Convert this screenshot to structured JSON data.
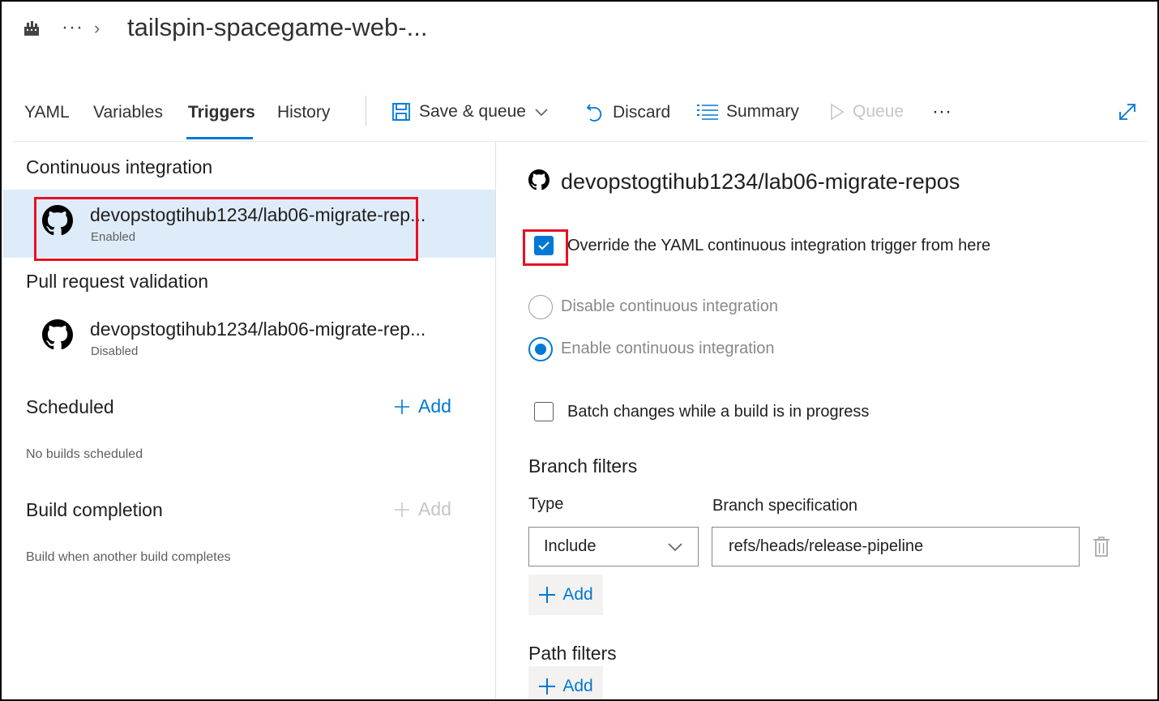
{
  "header": {
    "breadcrumb_more": "···",
    "breadcrumb_separator": "›",
    "title": "tailspin-spacegame-web-..."
  },
  "tabs": [
    {
      "label": "YAML"
    },
    {
      "label": "Variables"
    },
    {
      "label": "Triggers",
      "active": true
    },
    {
      "label": "History"
    }
  ],
  "toolbar": {
    "save_queue": "Save & queue",
    "discard": "Discard",
    "summary": "Summary",
    "queue": "Queue",
    "more": "···"
  },
  "left_panel": {
    "ci": {
      "title": "Continuous integration",
      "repo": "devopstogtihub1234/lab06-migrate-rep...",
      "status": "Enabled"
    },
    "pr": {
      "title": "Pull request validation",
      "repo": "devopstogtihub1234/lab06-migrate-rep...",
      "status": "Disabled"
    },
    "scheduled": {
      "title": "Scheduled",
      "add": "Add",
      "hint": "No builds scheduled"
    },
    "build_completion": {
      "title": "Build completion",
      "add": "Add",
      "hint": "Build when another build completes"
    }
  },
  "right_panel": {
    "repo_title": "devopstogtihub1234/lab06-migrate-repos",
    "override_label": "Override the YAML continuous integration trigger from here",
    "override_checked": true,
    "disable_ci": "Disable continuous integration",
    "enable_ci": "Enable continuous integration",
    "ci_selection": "enable",
    "batch_label": "Batch changes while a build is in progress",
    "batch_checked": false,
    "branch_filters": {
      "title": "Branch filters",
      "type_label": "Type",
      "spec_label": "Branch specification",
      "type_value": "Include",
      "spec_value": "refs/heads/release-pipeline",
      "add": "Add"
    },
    "path_filters": {
      "title": "Path filters",
      "add": "Add"
    }
  },
  "colors": {
    "accent": "#0078d4",
    "selected_row": "#deecf9",
    "highlight_box": "#e81123",
    "disabled_text": "#c8c6c4"
  }
}
